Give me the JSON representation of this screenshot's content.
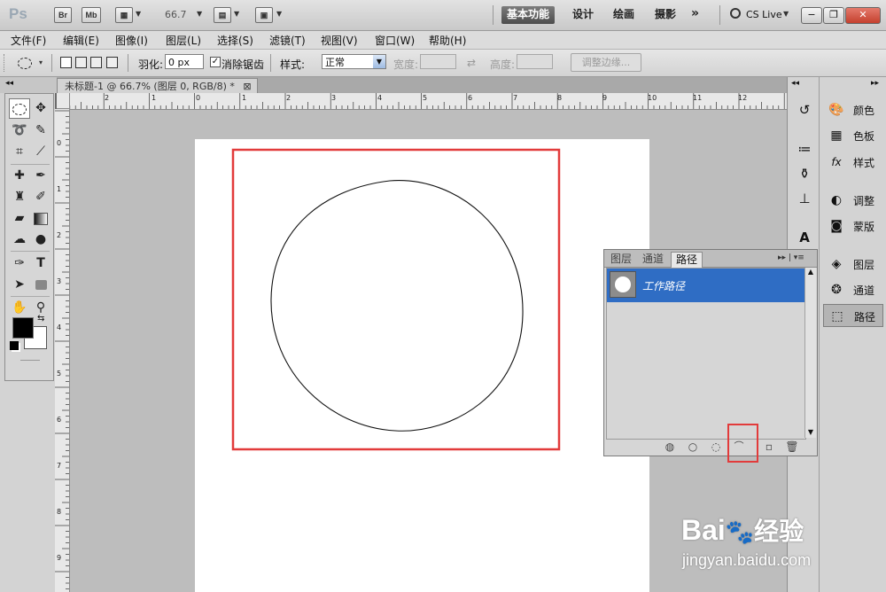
{
  "app": {
    "name": "Ps",
    "bridge": "Br",
    "minibridge": "Mb",
    "zoom": "66.7",
    "cs_live": "CS Live"
  },
  "workspaces": [
    "基本功能",
    "设计",
    "绘画",
    "摄影"
  ],
  "workspace_more": "»",
  "window_controls": {
    "minimize": "−",
    "restore": "❐",
    "close": "✕"
  },
  "menu": [
    "文件(F)",
    "编辑(E)",
    "图像(I)",
    "图层(L)",
    "选择(S)",
    "滤镜(T)",
    "视图(V)",
    "窗口(W)",
    "帮助(H)"
  ],
  "options": {
    "feather_label": "羽化:",
    "feather_value": "0 px",
    "antialias_label": "消除锯齿",
    "antialias_checked": true,
    "style_label": "样式:",
    "style_value": "正常",
    "width_label": "宽度:",
    "height_label": "高度:",
    "refine_edge": "调整边缘..."
  },
  "document": {
    "tab_title": "未标题-1 @ 66.7% (图层 0, RGB/8) *",
    "close": "⊠"
  },
  "ruler_top": [
    "2",
    "1",
    "0",
    "1",
    "2",
    "3",
    "4",
    "5",
    "6",
    "7",
    "8",
    "9",
    "10",
    "11",
    "12"
  ],
  "ruler_left": [
    "0",
    "1",
    "2",
    "3",
    "4",
    "5",
    "6",
    "7",
    "8",
    "9"
  ],
  "dock": {
    "collapse_left": "◂◂",
    "collapse_right": "▸▸"
  },
  "right_panels": [
    {
      "label": "颜色",
      "icon": "color-palette-icon"
    },
    {
      "label": "色板",
      "icon": "swatches-icon"
    },
    {
      "label": "样式",
      "icon": "styles-icon"
    },
    {
      "label": "调整",
      "icon": "adjustments-icon"
    },
    {
      "label": "蒙版",
      "icon": "masks-icon"
    },
    {
      "label": "图层",
      "icon": "layers-icon"
    },
    {
      "label": "通道",
      "icon": "channels-icon"
    },
    {
      "label": "路径",
      "icon": "paths-icon"
    }
  ],
  "paths_panel": {
    "tabs": [
      "图层",
      "通道",
      "路径"
    ],
    "active_tab": "路径",
    "menu": "▸▸ | ▾≡",
    "items": [
      {
        "name": "工作路径"
      }
    ]
  },
  "watermark": {
    "brand": "Bai",
    "brand_suffix": "经验",
    "url": "jingyan.baidu.com"
  },
  "colors": {
    "highlight": "#2f6dc4",
    "annotation": "#e23b3b",
    "canvas": "#ffffff",
    "workspace": "#bdbdbd"
  }
}
